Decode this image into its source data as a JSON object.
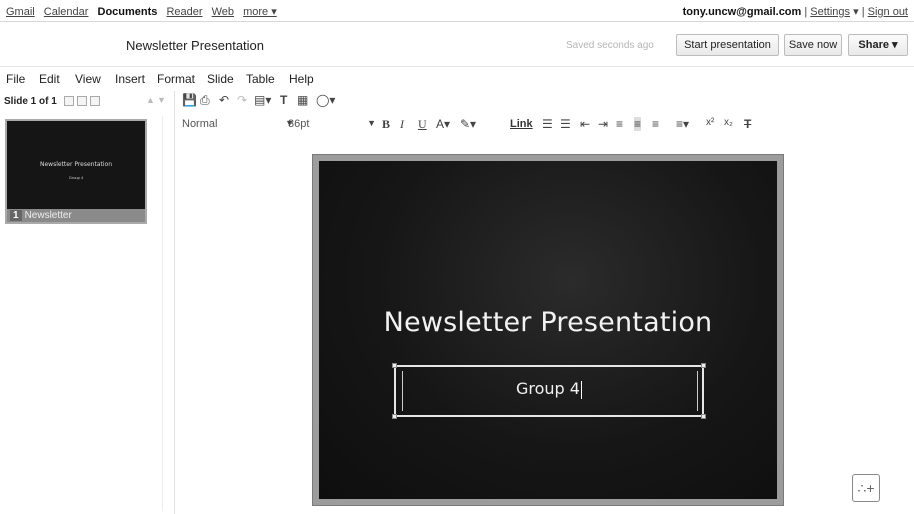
{
  "gbar": {
    "links": [
      "Gmail",
      "Calendar",
      "Documents",
      "Reader",
      "Web",
      "more ▾"
    ],
    "current": "Documents",
    "account_email": "tony.uncw@gmail.com",
    "settings_label": "Settings",
    "settings_caret": "▾",
    "signout_label": "Sign out",
    "separator": "|"
  },
  "titlebar": {
    "document_title": "Newsletter Presentation",
    "saved_status": "Saved seconds ago",
    "start_presentation_label": "Start presentation",
    "save_now_label": "Save now",
    "share_label": "Share ▾"
  },
  "menubar": {
    "items": [
      "File",
      "Edit",
      "View",
      "Insert",
      "Format",
      "Slide",
      "Table",
      "Help"
    ]
  },
  "leftpanel": {
    "slide_count": "Slide 1 of 1",
    "thumbnail": {
      "title": "Newsletter Presentation",
      "subtitle": "Group 4",
      "number": "1",
      "label": "Newsletter"
    }
  },
  "toolbar": {
    "style_value": "Normal",
    "font_size_value": "36pt",
    "link_label": "Link"
  },
  "slide": {
    "title": "Newsletter Presentation",
    "subtitle": "Group 4"
  },
  "colors": {
    "slide_background": "#111111",
    "slide_frame": "#9c9c9c",
    "slide_text": "#f2f2f2"
  }
}
